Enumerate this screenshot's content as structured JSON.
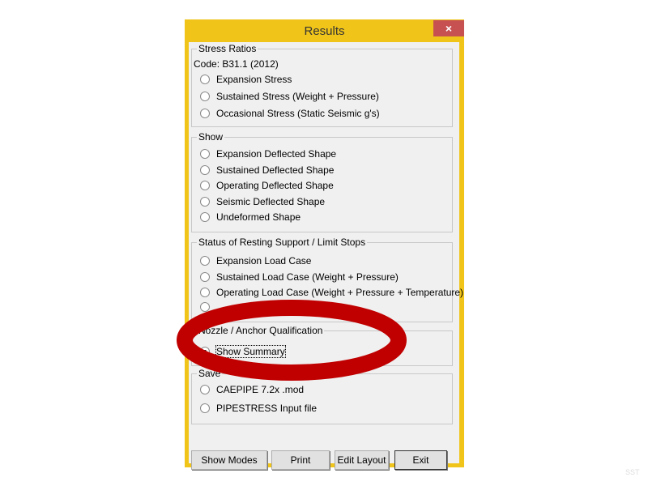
{
  "window": {
    "title": "Results",
    "close": "×"
  },
  "stress": {
    "title": "Stress Ratios",
    "code": "Code: B31.1 (2012)",
    "options": [
      "Expansion Stress",
      "Sustained Stress (Weight + Pressure)",
      "Occasional Stress (Static Seismic g's)"
    ]
  },
  "show": {
    "title": "Show",
    "options": [
      "Expansion Deflected Shape",
      "Sustained Deflected Shape",
      "Operating Deflected Shape",
      "Seismic Deflected Shape",
      "Undeformed Shape"
    ]
  },
  "status": {
    "title": "Status of Resting Support / Limit Stops",
    "options": [
      "Expansion Load Case",
      "Sustained Load Case (Weight + Pressure)",
      "Operating Load Case (Weight + Pressure + Temperature)"
    ]
  },
  "nozzle": {
    "title": "Nozzle / Anchor Qualification",
    "options": [
      "Show Summary"
    ],
    "selected": "Show Summary"
  },
  "save": {
    "title": "Save",
    "options": [
      "CAEPIPE 7.2x .mod",
      "PIPESTRESS Input file"
    ]
  },
  "buttons": {
    "show_modes": "Show Modes",
    "print": "Print",
    "edit_layout": "Edit Layout",
    "exit": "Exit"
  },
  "annotation_color": "#c00000",
  "watermark": "SST"
}
